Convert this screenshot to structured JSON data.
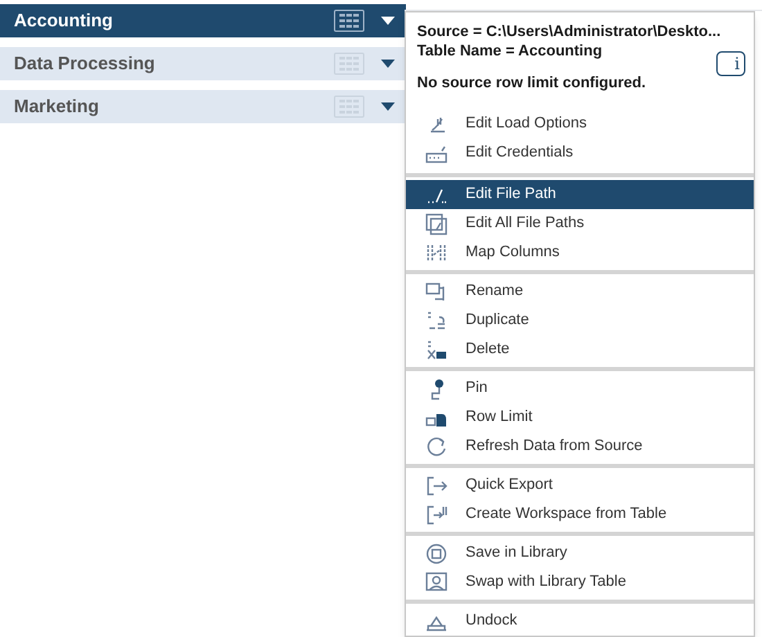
{
  "sidebar": {
    "items": [
      {
        "label": "Accounting",
        "selected": true
      },
      {
        "label": "Data Processing",
        "selected": false
      },
      {
        "label": "Marketing",
        "selected": false
      }
    ]
  },
  "context_menu": {
    "info_lines": [
      "Source = C:\\Users\\Administrator\\Deskto...",
      "Table Name = Accounting"
    ],
    "row_limit_note": "No source row limit configured.",
    "info_button": "i",
    "groups": [
      [
        {
          "label": "Edit Load Options",
          "selected": false
        },
        {
          "label": "Edit Credentials",
          "selected": false
        }
      ],
      [
        {
          "label": "Edit File Path",
          "selected": true
        },
        {
          "label": "Edit All File Paths",
          "selected": false
        },
        {
          "label": "Map Columns",
          "selected": false
        }
      ],
      [
        {
          "label": "Rename",
          "selected": false
        },
        {
          "label": "Duplicate",
          "selected": false
        },
        {
          "label": "Delete",
          "selected": false
        }
      ],
      [
        {
          "label": "Pin",
          "selected": false
        },
        {
          "label": "Row Limit",
          "selected": false
        },
        {
          "label": "Refresh Data from Source",
          "selected": false
        }
      ],
      [
        {
          "label": "Quick Export",
          "selected": false
        },
        {
          "label": "Create Workspace from Table",
          "selected": false
        }
      ],
      [
        {
          "label": "Save in Library",
          "selected": false
        },
        {
          "label": "Swap with Library Table",
          "selected": false
        }
      ],
      [
        {
          "label": "Undock",
          "selected": false
        }
      ]
    ]
  }
}
